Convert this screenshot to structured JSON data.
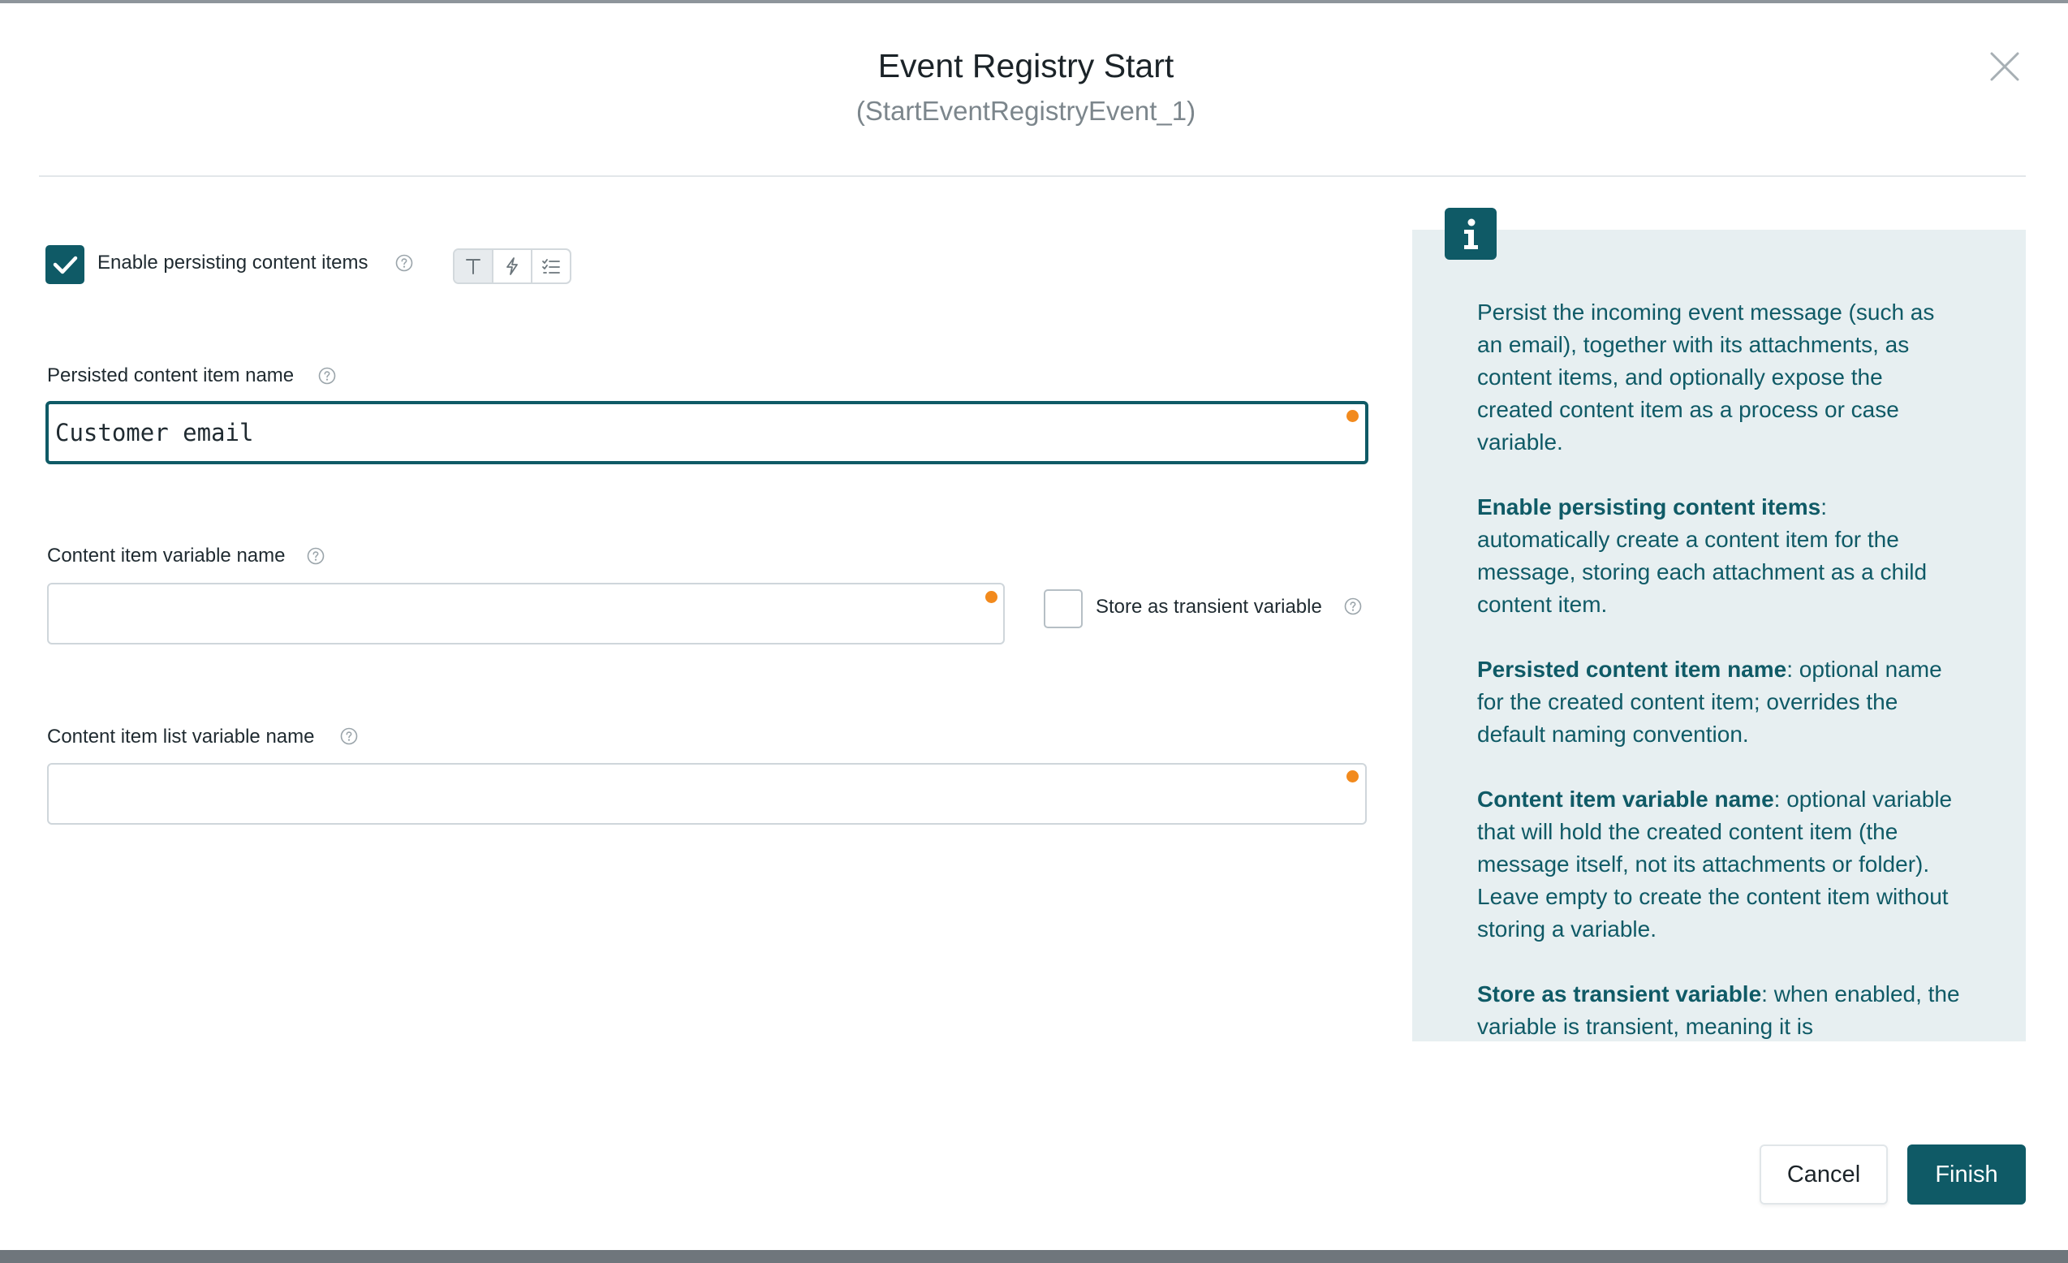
{
  "dialog": {
    "title": "Event Registry Start",
    "subtitle": "(StartEventRegistryEvent_1)",
    "close_icon": "close-icon"
  },
  "form": {
    "enable_persisting": {
      "label": "Enable persisting content items",
      "checked": true,
      "value_type_options": [
        "text-icon",
        "expression-icon",
        "list-icon"
      ],
      "selected_value_type": "text-icon"
    },
    "persisted_name": {
      "label": "Persisted content item name",
      "value": "Customer email",
      "focused": true
    },
    "variable_name": {
      "label": "Content item variable name",
      "value": ""
    },
    "transient": {
      "label": "Store as transient variable",
      "checked": false
    },
    "list_variable_name": {
      "label": "Content item list variable name",
      "value": ""
    }
  },
  "info": {
    "icon": "info-icon",
    "intro": "Persist the incoming event message (such as an email), together with its attachments, as content items, and optionally expose the created content item as a process or case variable.",
    "items": [
      {
        "term": "Enable persisting content items",
        "text": ": automatically create a content item for the message, storing each attachment as a child content item."
      },
      {
        "term": "Persisted content item name",
        "text": ": optional name for the created content item; overrides the default naming convention."
      },
      {
        "term": "Content item variable name",
        "text": ": optional variable that will hold the created content item (the message itself, not its attachments or folder). Leave empty to create the content item without storing a variable."
      },
      {
        "term": "Store as transient variable",
        "text": ": when enabled, the variable is transient, meaning it is"
      }
    ]
  },
  "buttons": {
    "cancel": "Cancel",
    "finish": "Finish"
  },
  "colors": {
    "accent": "#0f5a66",
    "required_dot": "#f28a1d",
    "info_panel_bg": "#e7eff1"
  }
}
